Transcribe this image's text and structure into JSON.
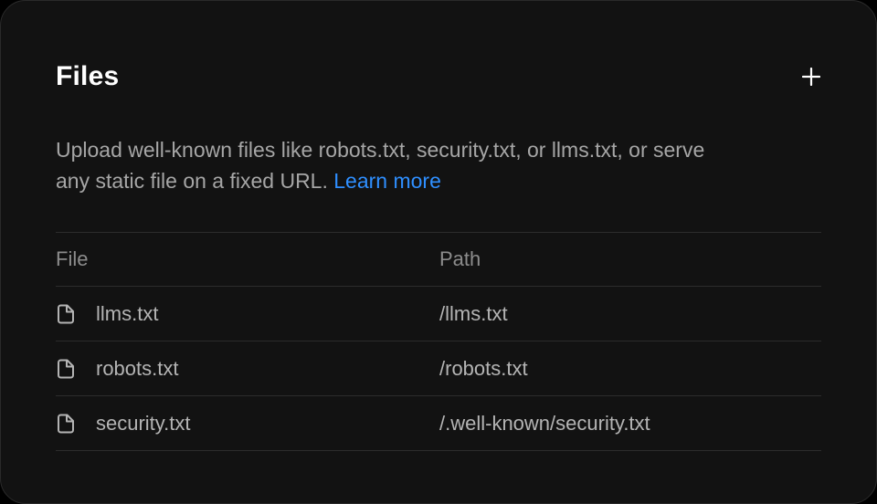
{
  "card": {
    "title": "Files",
    "add_icon": "plus-icon",
    "description_text": "Upload well-known files like robots.txt, security.txt, or llms.txt, or serve any static file on a fixed URL.",
    "learn_more": "Learn more"
  },
  "table": {
    "headers": {
      "file": "File",
      "path": "Path"
    },
    "rows": [
      {
        "icon": "file-icon",
        "file": "llms.txt",
        "path": "/llms.txt"
      },
      {
        "icon": "file-icon",
        "file": "robots.txt",
        "path": "/robots.txt"
      },
      {
        "icon": "file-icon",
        "file": "security.txt",
        "path": "/.well-known/security.txt"
      }
    ]
  },
  "colors": {
    "background": "#121212",
    "text": "#a6a6a6",
    "link": "#2f8fff",
    "divider": "#2c2c2c"
  }
}
